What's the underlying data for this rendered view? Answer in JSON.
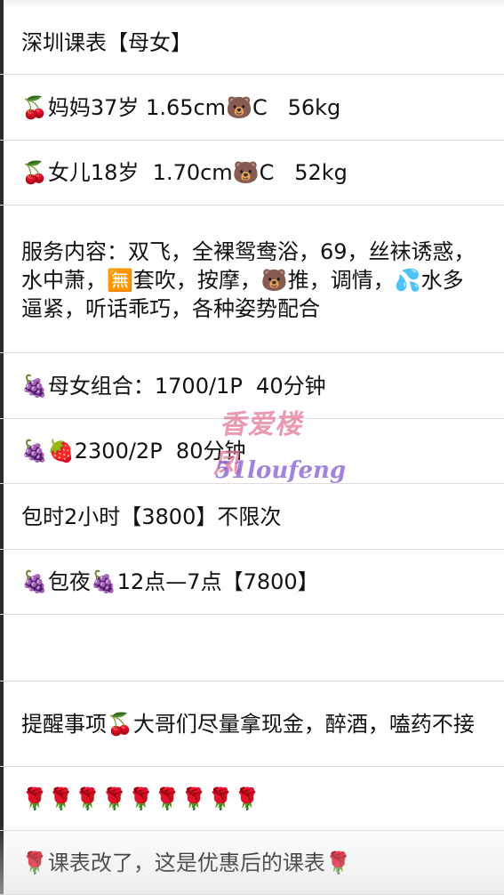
{
  "notes": {
    "lines": [
      "深圳课表【母女】",
      "🍒妈妈37岁 1.65cm🐻C   56kg",
      "🍒女儿18岁  1.70cm🐻C   52kg",
      "服务内容：双飞，全裸鸳鸯浴，69，丝袜诱惑，水中萧，🈚套吹，按摩，🐻推，调情，💦水多逼紧，听话乖巧，各种姿势配合",
      "🍇母女组合：1700/1P  40分钟",
      "🍇🍓2300/2P  80分钟",
      "包时2小时【3800】不限次",
      "🍇包夜🍇12点—7点【7800】",
      "",
      "提醒事项🍒大哥们尽量拿现金，醉酒，嗑药不接",
      "🌹🌹🌹🌹🌹🌹🌹🌹🌹",
      "🌹课表改了，这是优惠后的课表🌹"
    ]
  },
  "watermark": {
    "chinese": "香爱楼凤",
    "latin": "51loufeng"
  },
  "colors": {
    "background": "#ffffff",
    "text": "#111111",
    "divider": "#dedede",
    "watermark_pink": "#e1789a",
    "watermark_purple": "#825ad2"
  }
}
